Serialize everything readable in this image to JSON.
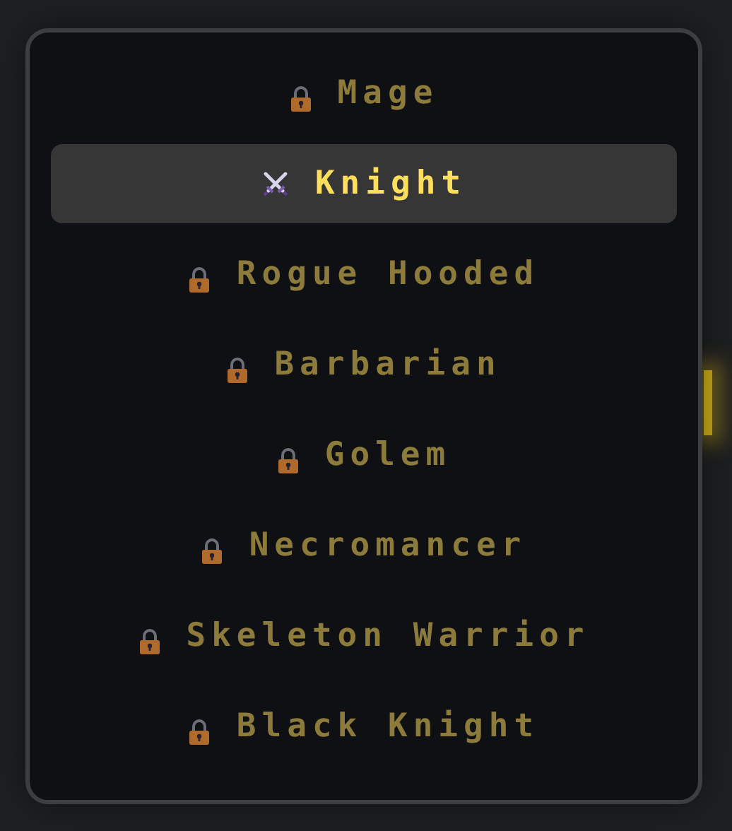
{
  "characters": [
    {
      "label": "Mage",
      "locked": true,
      "selected": false
    },
    {
      "label": "Knight",
      "locked": false,
      "selected": true
    },
    {
      "label": "Rogue Hooded",
      "locked": true,
      "selected": false
    },
    {
      "label": "Barbarian",
      "locked": true,
      "selected": false
    },
    {
      "label": "Golem",
      "locked": true,
      "selected": false
    },
    {
      "label": "Necromancer",
      "locked": true,
      "selected": false
    },
    {
      "label": "Skeleton Warrior",
      "locked": true,
      "selected": false
    },
    {
      "label": "Black Knight",
      "locked": true,
      "selected": false
    }
  ]
}
